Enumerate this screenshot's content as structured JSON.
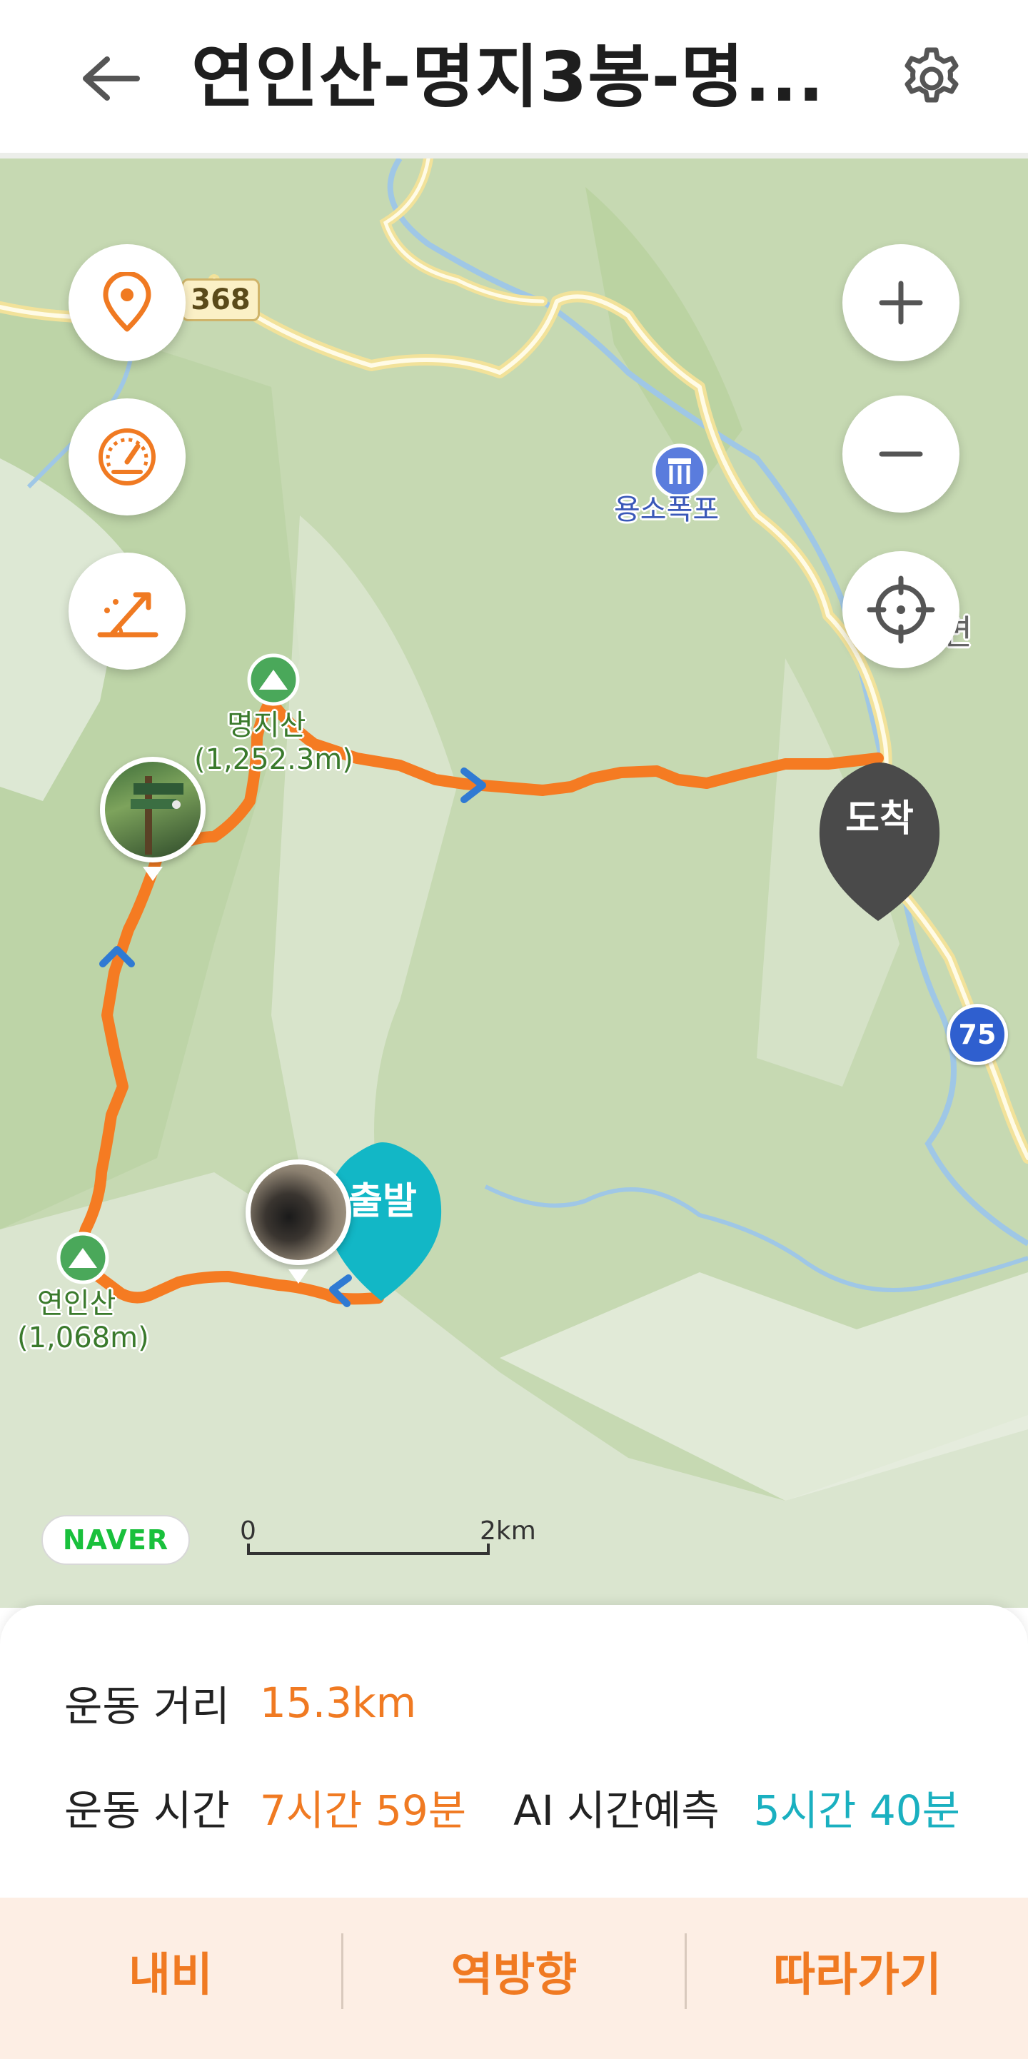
{
  "header": {
    "title": "연인산-명지3봉-명...",
    "back_icon": "arrow-left-icon",
    "settings_icon": "gear-icon"
  },
  "map": {
    "controls": {
      "left": [
        "location-pin-icon",
        "speedometer-icon",
        "slope-icon"
      ],
      "right": [
        "zoom-in-icon",
        "zoom-out-icon",
        "crosshair-icon"
      ]
    },
    "route_sign": "368",
    "highway_sign": "75",
    "labels": {
      "waterfall": "용소폭포",
      "peak_1_name": "명지산",
      "peak_1_elev": "(1,252.3m)",
      "peak_2_name": "연인산",
      "peak_2_elev": "(1,068m)",
      "edge_text": "면"
    },
    "start_pin": "출발",
    "end_pin": "도착",
    "attribution": "NAVER",
    "scale": {
      "start": "0",
      "end": "2km"
    },
    "colors": {
      "route": "#f57b22",
      "start_pin": "#12b7c6",
      "end_pin": "#4a4a4a"
    }
  },
  "stats": {
    "distance_label": "운동 거리",
    "distance_value": "15.3km",
    "time_label": "운동 시간",
    "time_value": "7시간 59분",
    "ai_label": "AI 시간예측",
    "ai_value": "5시간 40분"
  },
  "actions": {
    "navigate": "내비",
    "reverse": "역방향",
    "follow": "따라가기"
  }
}
